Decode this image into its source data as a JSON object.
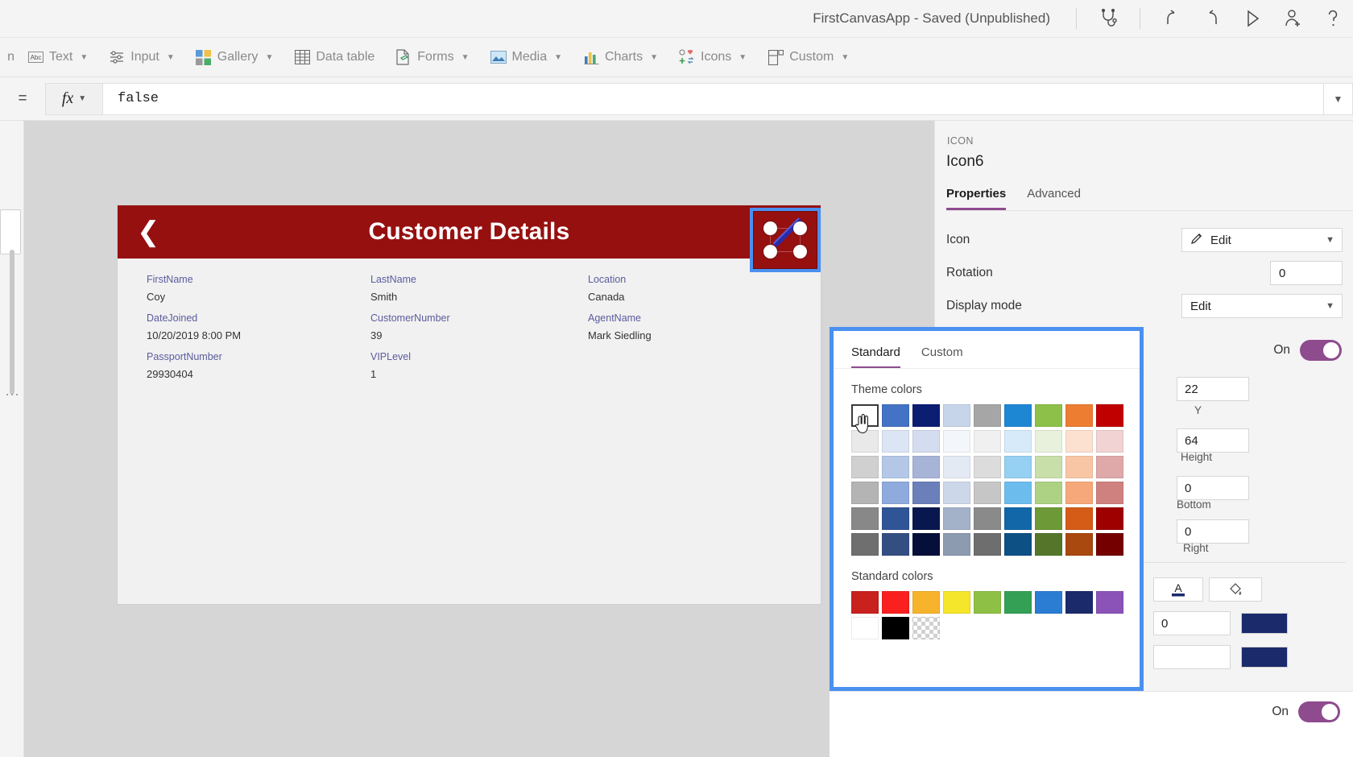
{
  "topbar": {
    "app_title": "FirstCanvasApp - Saved (Unpublished)",
    "icons": [
      {
        "name": "app-checker-icon",
        "label": "App checker"
      },
      {
        "name": "undo-icon",
        "label": "Undo"
      },
      {
        "name": "redo-icon",
        "label": "Redo"
      },
      {
        "name": "preview-play-icon",
        "label": "Preview the app"
      },
      {
        "name": "share-user-icon",
        "label": "Share"
      },
      {
        "name": "help-icon",
        "label": "Help"
      }
    ]
  },
  "ribbon": {
    "left_stub": "n",
    "items": [
      {
        "label": "Text",
        "icon": "text-abc-icon",
        "has_chevron": true
      },
      {
        "label": "Input",
        "icon": "sliders-input-icon",
        "has_chevron": true
      },
      {
        "label": "Gallery",
        "icon": "gallery-grid-icon",
        "has_chevron": true
      },
      {
        "label": "Data table",
        "icon": "data-table-icon",
        "has_chevron": false
      },
      {
        "label": "Forms",
        "icon": "forms-document-icon",
        "has_chevron": true
      },
      {
        "label": "Media",
        "icon": "media-picture-icon",
        "has_chevron": true
      },
      {
        "label": "Charts",
        "icon": "charts-bar-icon",
        "has_chevron": true
      },
      {
        "label": "Icons",
        "icon": "icons-shapes-icon",
        "has_chevron": true
      },
      {
        "label": "Custom",
        "icon": "custom-component-icon",
        "has_chevron": true
      }
    ]
  },
  "formula_bar": {
    "equals": "=",
    "fx_label": "fx",
    "value": "false"
  },
  "canvas": {
    "app_header": {
      "title": "Customer Details",
      "background": "#961010",
      "back_icon": "chevron-left-icon"
    },
    "selected_control": {
      "name": "Icon6",
      "selection_color": "#4a90f0",
      "icon": "edit-pencil-icon"
    },
    "form_fields": [
      {
        "label": "FirstName",
        "value": "Coy"
      },
      {
        "label": "LastName",
        "value": "Smith"
      },
      {
        "label": "Location",
        "value": "Canada"
      },
      {
        "label": "DateJoined",
        "value": "10/20/2019 8:00 PM"
      },
      {
        "label": "CustomerNumber",
        "value": "39"
      },
      {
        "label": "AgentName",
        "value": "Mark Siedling"
      },
      {
        "label": "PassportNumber",
        "value": "29930404"
      },
      {
        "label": "VIPLevel",
        "value": "1"
      }
    ]
  },
  "properties_panel": {
    "kind": "ICON",
    "control_name": "Icon6",
    "tabs": [
      {
        "label": "Properties",
        "active": true
      },
      {
        "label": "Advanced",
        "active": false
      }
    ],
    "rows": [
      {
        "label": "Icon",
        "value": "Edit",
        "type": "dropdown",
        "icon": "edit-pencil-icon"
      },
      {
        "label": "Rotation",
        "value": "0",
        "type": "number"
      },
      {
        "label": "Display mode",
        "value": "Edit",
        "type": "dropdown"
      }
    ],
    "visible_toggle": {
      "label": "On",
      "state": "on",
      "accent": "#8e4b8e"
    },
    "position": {
      "y_value": "22",
      "y_label": "Y",
      "height_value": "64",
      "height_label": "Height",
      "width_label_partial": "h",
      "bottom_value": "0",
      "bottom_label": "Bottom",
      "right_value": "0",
      "right_label": "Right"
    },
    "text_tools": {
      "font_color_icon": "font-color-A-icon",
      "fill_color_icon": "fill-bucket-icon",
      "border_value": "0",
      "swatch_1": "#1b2a6b",
      "swatch_2": "#1b2a6b"
    },
    "bottom_toggle": {
      "label": "On",
      "state": "on"
    }
  },
  "color_picker": {
    "border_color": "#4a90f0",
    "tabs": [
      {
        "label": "Standard",
        "active": true
      },
      {
        "label": "Custom",
        "active": false
      }
    ],
    "theme_colors_label": "Theme colors",
    "standard_colors_label": "Standard colors",
    "cursor": "pointer-hand-cursor",
    "theme_colors": [
      [
        "#ffffff",
        "#4472c4",
        "#0c1e72",
        "#c7d5ea",
        "#a6a6a6",
        "#1d87d4",
        "#8cc049",
        "#ed7d31",
        "#c00000"
      ],
      [
        "#e9e9e9",
        "#dbe5f4",
        "#d4dcef",
        "#f3f6fb",
        "#f0f0f0",
        "#d6eafa",
        "#e8f1dc",
        "#fce0d0",
        "#f1d3d3"
      ],
      [
        "#d0d0d0",
        "#b4c7e7",
        "#a7b4d8",
        "#e4eaf4",
        "#dcdcdc",
        "#96d0f2",
        "#c8dfaa",
        "#f9c6a5",
        "#dfa9a9"
      ],
      [
        "#b4b4b4",
        "#8faadc",
        "#6b7fba",
        "#ccd8ea",
        "#c6c6c6",
        "#6cbdee",
        "#aed284",
        "#f6a87a",
        "#cf8180"
      ],
      [
        "#888888",
        "#2f5597",
        "#09174f",
        "#a3b2c9",
        "#8a8a8a",
        "#1167a8",
        "#6d9936",
        "#d55c17",
        "#9e0000"
      ],
      [
        "#6f6f6f",
        "#334f82",
        "#060f3a",
        "#8d9bb1",
        "#6e6e6e",
        "#0d5084",
        "#55762a",
        "#a9480f",
        "#740000"
      ]
    ],
    "standard_colors_row1": [
      "#c9211e",
      "#fa2020",
      "#f7b32b",
      "#f5e52b",
      "#8fc046",
      "#33a055",
      "#2b7cd3",
      "#1b2a6b",
      "#8b52b8"
    ],
    "standard_colors_row2": [
      "#ffffff",
      "#000000",
      "transparent"
    ]
  }
}
